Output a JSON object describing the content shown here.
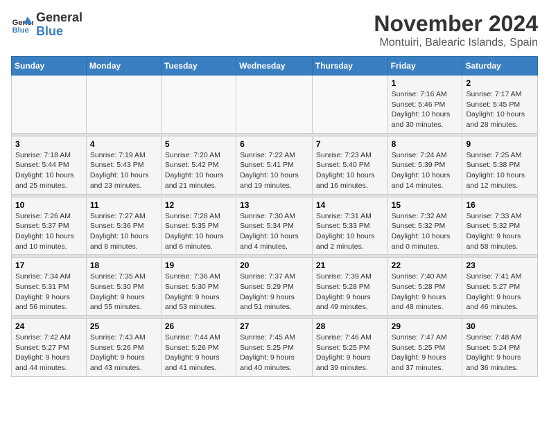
{
  "logo": {
    "text_general": "General",
    "text_blue": "Blue"
  },
  "header": {
    "month": "November 2024",
    "location": "Montuiri, Balearic Islands, Spain"
  },
  "columns": [
    "Sunday",
    "Monday",
    "Tuesday",
    "Wednesday",
    "Thursday",
    "Friday",
    "Saturday"
  ],
  "weeks": [
    [
      {
        "day": "",
        "info": ""
      },
      {
        "day": "",
        "info": ""
      },
      {
        "day": "",
        "info": ""
      },
      {
        "day": "",
        "info": ""
      },
      {
        "day": "",
        "info": ""
      },
      {
        "day": "1",
        "info": "Sunrise: 7:16 AM\nSunset: 5:46 PM\nDaylight: 10 hours and 30 minutes."
      },
      {
        "day": "2",
        "info": "Sunrise: 7:17 AM\nSunset: 5:45 PM\nDaylight: 10 hours and 28 minutes."
      }
    ],
    [
      {
        "day": "3",
        "info": "Sunrise: 7:18 AM\nSunset: 5:44 PM\nDaylight: 10 hours and 25 minutes."
      },
      {
        "day": "4",
        "info": "Sunrise: 7:19 AM\nSunset: 5:43 PM\nDaylight: 10 hours and 23 minutes."
      },
      {
        "day": "5",
        "info": "Sunrise: 7:20 AM\nSunset: 5:42 PM\nDaylight: 10 hours and 21 minutes."
      },
      {
        "day": "6",
        "info": "Sunrise: 7:22 AM\nSunset: 5:41 PM\nDaylight: 10 hours and 19 minutes."
      },
      {
        "day": "7",
        "info": "Sunrise: 7:23 AM\nSunset: 5:40 PM\nDaylight: 10 hours and 16 minutes."
      },
      {
        "day": "8",
        "info": "Sunrise: 7:24 AM\nSunset: 5:39 PM\nDaylight: 10 hours and 14 minutes."
      },
      {
        "day": "9",
        "info": "Sunrise: 7:25 AM\nSunset: 5:38 PM\nDaylight: 10 hours and 12 minutes."
      }
    ],
    [
      {
        "day": "10",
        "info": "Sunrise: 7:26 AM\nSunset: 5:37 PM\nDaylight: 10 hours and 10 minutes."
      },
      {
        "day": "11",
        "info": "Sunrise: 7:27 AM\nSunset: 5:36 PM\nDaylight: 10 hours and 8 minutes."
      },
      {
        "day": "12",
        "info": "Sunrise: 7:28 AM\nSunset: 5:35 PM\nDaylight: 10 hours and 6 minutes."
      },
      {
        "day": "13",
        "info": "Sunrise: 7:30 AM\nSunset: 5:34 PM\nDaylight: 10 hours and 4 minutes."
      },
      {
        "day": "14",
        "info": "Sunrise: 7:31 AM\nSunset: 5:33 PM\nDaylight: 10 hours and 2 minutes."
      },
      {
        "day": "15",
        "info": "Sunrise: 7:32 AM\nSunset: 5:32 PM\nDaylight: 10 hours and 0 minutes."
      },
      {
        "day": "16",
        "info": "Sunrise: 7:33 AM\nSunset: 5:32 PM\nDaylight: 9 hours and 58 minutes."
      }
    ],
    [
      {
        "day": "17",
        "info": "Sunrise: 7:34 AM\nSunset: 5:31 PM\nDaylight: 9 hours and 56 minutes."
      },
      {
        "day": "18",
        "info": "Sunrise: 7:35 AM\nSunset: 5:30 PM\nDaylight: 9 hours and 55 minutes."
      },
      {
        "day": "19",
        "info": "Sunrise: 7:36 AM\nSunset: 5:30 PM\nDaylight: 9 hours and 53 minutes."
      },
      {
        "day": "20",
        "info": "Sunrise: 7:37 AM\nSunset: 5:29 PM\nDaylight: 9 hours and 51 minutes."
      },
      {
        "day": "21",
        "info": "Sunrise: 7:39 AM\nSunset: 5:28 PM\nDaylight: 9 hours and 49 minutes."
      },
      {
        "day": "22",
        "info": "Sunrise: 7:40 AM\nSunset: 5:28 PM\nDaylight: 9 hours and 48 minutes."
      },
      {
        "day": "23",
        "info": "Sunrise: 7:41 AM\nSunset: 5:27 PM\nDaylight: 9 hours and 46 minutes."
      }
    ],
    [
      {
        "day": "24",
        "info": "Sunrise: 7:42 AM\nSunset: 5:27 PM\nDaylight: 9 hours and 44 minutes."
      },
      {
        "day": "25",
        "info": "Sunrise: 7:43 AM\nSunset: 5:26 PM\nDaylight: 9 hours and 43 minutes."
      },
      {
        "day": "26",
        "info": "Sunrise: 7:44 AM\nSunset: 5:26 PM\nDaylight: 9 hours and 41 minutes."
      },
      {
        "day": "27",
        "info": "Sunrise: 7:45 AM\nSunset: 5:25 PM\nDaylight: 9 hours and 40 minutes."
      },
      {
        "day": "28",
        "info": "Sunrise: 7:46 AM\nSunset: 5:25 PM\nDaylight: 9 hours and 39 minutes."
      },
      {
        "day": "29",
        "info": "Sunrise: 7:47 AM\nSunset: 5:25 PM\nDaylight: 9 hours and 37 minutes."
      },
      {
        "day": "30",
        "info": "Sunrise: 7:48 AM\nSunset: 5:24 PM\nDaylight: 9 hours and 36 minutes."
      }
    ]
  ]
}
